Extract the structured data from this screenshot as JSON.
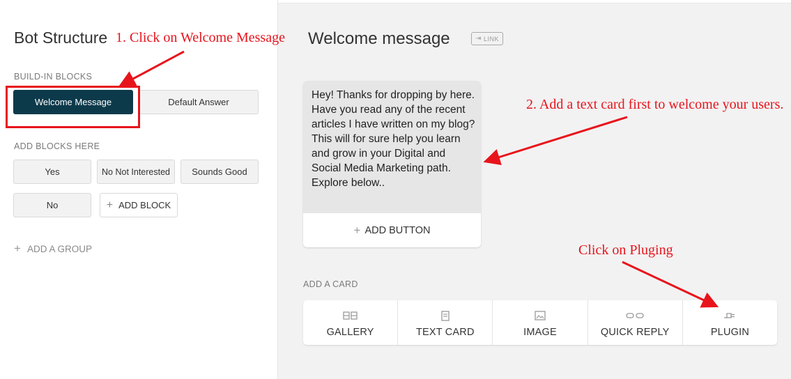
{
  "sidebar": {
    "title": "Bot Structure",
    "builtin_label": "BUILD-IN BLOCKS",
    "builtin_blocks": [
      "Welcome Message",
      "Default Answer"
    ],
    "add_blocks_label": "ADD BLOCKS HERE",
    "blocks": [
      "Yes",
      "No Not Interested",
      "Sounds Good",
      "No"
    ],
    "add_block_label": "ADD BLOCK",
    "add_group_label": "ADD A GROUP"
  },
  "main": {
    "title": "Welcome message",
    "link_badge": "LINK",
    "text_card": {
      "message": "Hey! Thanks for dropping by here. Have you read any of the recent articles I have written on my blog? This will for sure help you learn and grow in your Digital and Social Media Marketing path.\n Explore below..",
      "add_button_label": "ADD BUTTON"
    },
    "add_card_label": "ADD A CARD",
    "card_options": [
      {
        "label": "GALLERY",
        "icon": "gallery-icon"
      },
      {
        "label": "TEXT CARD",
        "icon": "text-card-icon"
      },
      {
        "label": "IMAGE",
        "icon": "image-icon"
      },
      {
        "label": "QUICK REPLY",
        "icon": "quick-reply-icon"
      },
      {
        "label": "PLUGIN",
        "icon": "plugin-icon"
      }
    ]
  },
  "annotations": {
    "step1": "1. Click on Welcome Message",
    "step2": "2. Add a text card first to welcome your users.",
    "step3": "Click on Pluging"
  },
  "colors": {
    "selected_block": "#0d3a4b",
    "annotation": "#e8141c"
  }
}
